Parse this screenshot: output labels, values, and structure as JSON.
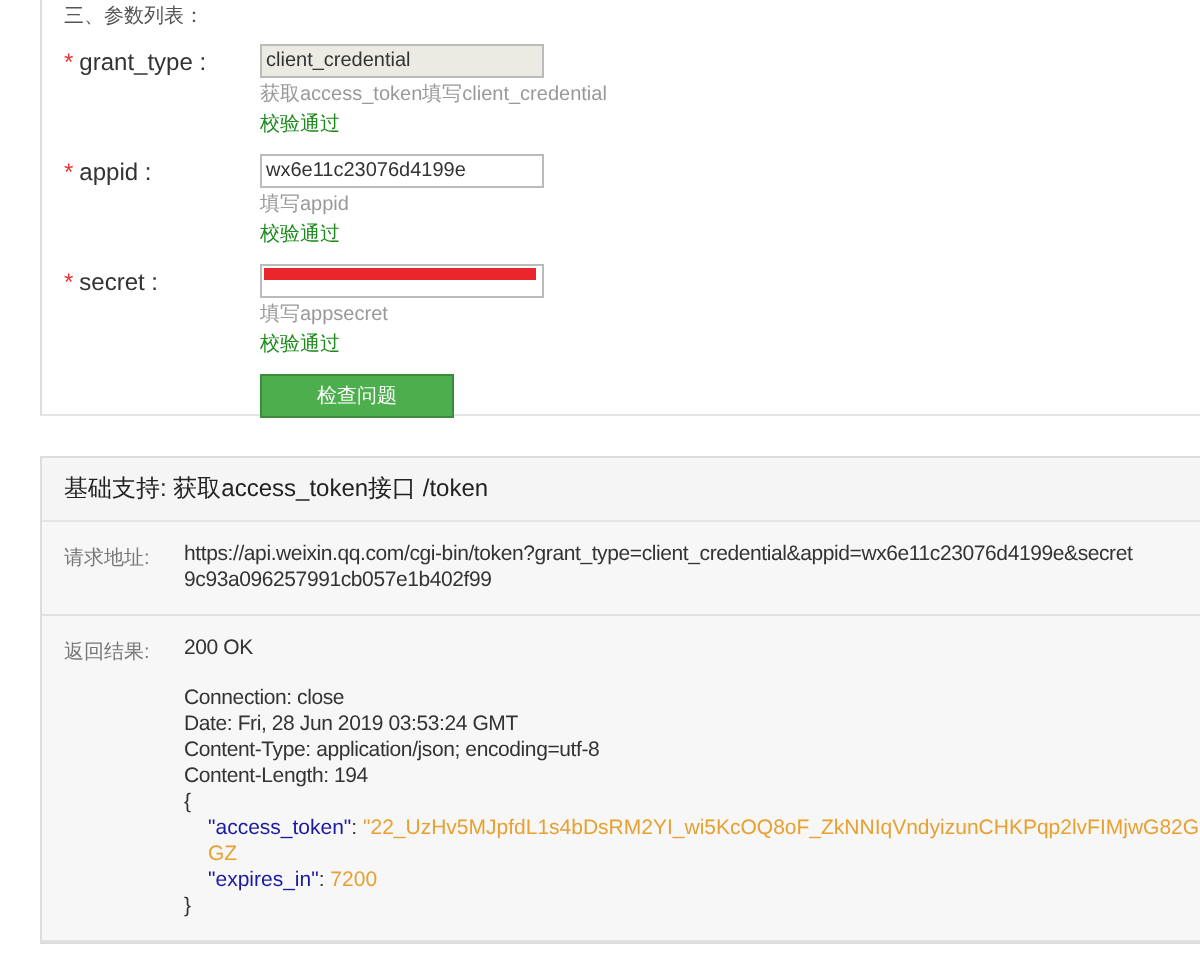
{
  "params_section": {
    "heading": "三、参数列表：",
    "fields": [
      {
        "label": "grant_type :",
        "marker": "*",
        "value": "client_credential",
        "disabled": true,
        "redacted": false,
        "hint": "获取access_token填写client_credential",
        "status": "校验通过"
      },
      {
        "label": "appid :",
        "marker": "*",
        "value": "wx6e11c23076d4199e",
        "disabled": false,
        "redacted": false,
        "hint": "填写appid",
        "status": "校验通过"
      },
      {
        "label": "secret :",
        "marker": "*",
        "disabled": false,
        "redacted": true,
        "hint": "填写appsecret",
        "status": "校验通过"
      }
    ],
    "button": "检查问题"
  },
  "result_panel": {
    "title": "基础支持: 获取access_token接口 /token",
    "request": {
      "label": "请求地址:",
      "lines": [
        "https://api.weixin.qq.com/cgi-bin/token?grant_type=client_credential&appid=wx6e11c23076d4199e&secret",
        "9c93a096257991cb057e1b402f99"
      ]
    },
    "response": {
      "label": "返回结果:",
      "status": "200 OK",
      "headers": [
        "Connection: close",
        "Date: Fri, 28 Jun 2019 03:53:24 GMT",
        "Content-Type: application/json; encoding=utf-8",
        "Content-Length: 194"
      ],
      "open_brace": "{",
      "entries": [
        {
          "key": "\"access_token\"",
          "sep": ":",
          "value": "\"22_UzHv5MJpfdL1s4bDsRM2YI_wi5KcOQ8oF_ZkNNIqVndyizunCHKPqp2lvFIMjwG82GGZ"
        },
        {
          "key": "\"expires_in\"",
          "sep": ":",
          "value": "7200"
        }
      ],
      "close_brace": "}"
    }
  }
}
